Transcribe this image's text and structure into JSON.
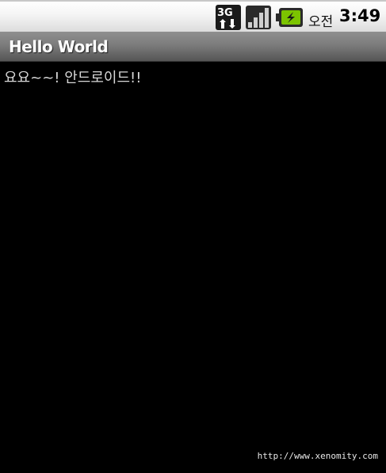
{
  "status_bar": {
    "network_label": "3G",
    "ampm": "오전",
    "time": "3:49"
  },
  "title_bar": {
    "title": "Hello World"
  },
  "content": {
    "text": "요요~~! 안드로이드!!"
  },
  "watermark": {
    "url": "http://www.xenomity.com"
  },
  "colors": {
    "battery_charge": "#7cc400",
    "background": "#000000",
    "title_bar": "#7c7c7c"
  }
}
